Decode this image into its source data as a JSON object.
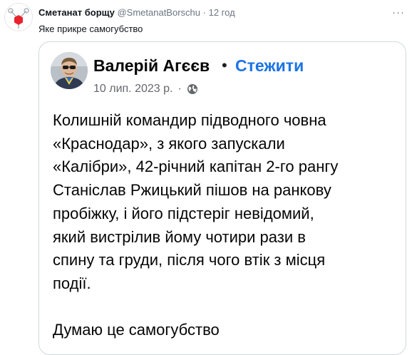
{
  "tweet": {
    "author_name": "Сметанат борщу",
    "handle": "@SmetanatBorschu",
    "separator": "·",
    "time": "12 год",
    "more_icon": "more-horizontal-icon",
    "text": "Яке прикре самогубство"
  },
  "embedded_post": {
    "author_name": "Валерій Агєєв",
    "separator": "•",
    "follow_label": "Стежити",
    "date": "10 лип. 2023 р.",
    "meta_separator": "·",
    "audience_icon": "globe-icon",
    "body_lines": [
      "Колишній командир підводного човна",
      "«Краснодар», з якого запускали",
      "«Калібри», 42-річний капітан 2-го рангу",
      "Станіслав Ржицький пішов на ранкову",
      "пробіжку, і його підстеріг невідомий,",
      "який вистрілив йому чотири рази в",
      "спину та груди, після чого втік з місця",
      "події."
    ],
    "closing": "Думаю це самогубство"
  },
  "colors": {
    "text": "#0f1419",
    "secondary": "#6b7580",
    "border": "#cfd9de",
    "follow_blue": "#1b74e4",
    "avatar_red": "#e8232d"
  }
}
